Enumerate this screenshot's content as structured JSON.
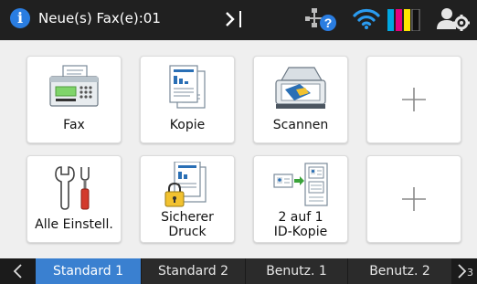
{
  "status_bar": {
    "info_icon": "i",
    "fax_message": "Neue(s) Fax(e):01",
    "icons": [
      "network-help-icon",
      "wifi-icon",
      "toner-level-icon",
      "admin-settings-icon"
    ],
    "colors": {
      "background": "#202020",
      "info": "#2a7de1",
      "wifi": "#2a9cf0",
      "toner_cyan": "#00a7e1",
      "toner_magenta": "#e4007f",
      "toner_yellow": "#ffe500",
      "toner_black": "#111111"
    }
  },
  "tiles": [
    {
      "id": "fax",
      "label": "Fax",
      "icon": "fax-icon"
    },
    {
      "id": "copy",
      "label": "Kopie",
      "icon": "copy-icon"
    },
    {
      "id": "scan",
      "label": "Scannen",
      "icon": "scanner-icon"
    },
    {
      "id": "add1",
      "label": "",
      "icon": "plus-icon"
    },
    {
      "id": "settings",
      "label": "Alle Einstell.",
      "icon": "tools-icon"
    },
    {
      "id": "secure_print",
      "label_lines": [
        "Sicherer",
        "Druck"
      ],
      "icon": "secure-print-icon"
    },
    {
      "id": "id_copy",
      "label_lines": [
        "2 auf 1",
        "ID-Kopie"
      ],
      "icon": "id-copy-icon"
    },
    {
      "id": "add2",
      "label": "",
      "icon": "plus-icon"
    }
  ],
  "tab_bar": {
    "tabs": [
      "Standard 1",
      "Standard 2",
      "Benutz. 1",
      "Benutz. 2"
    ],
    "active_tab": "Standard 1",
    "next_indicator": "3",
    "active_color": "#3a80d0"
  }
}
